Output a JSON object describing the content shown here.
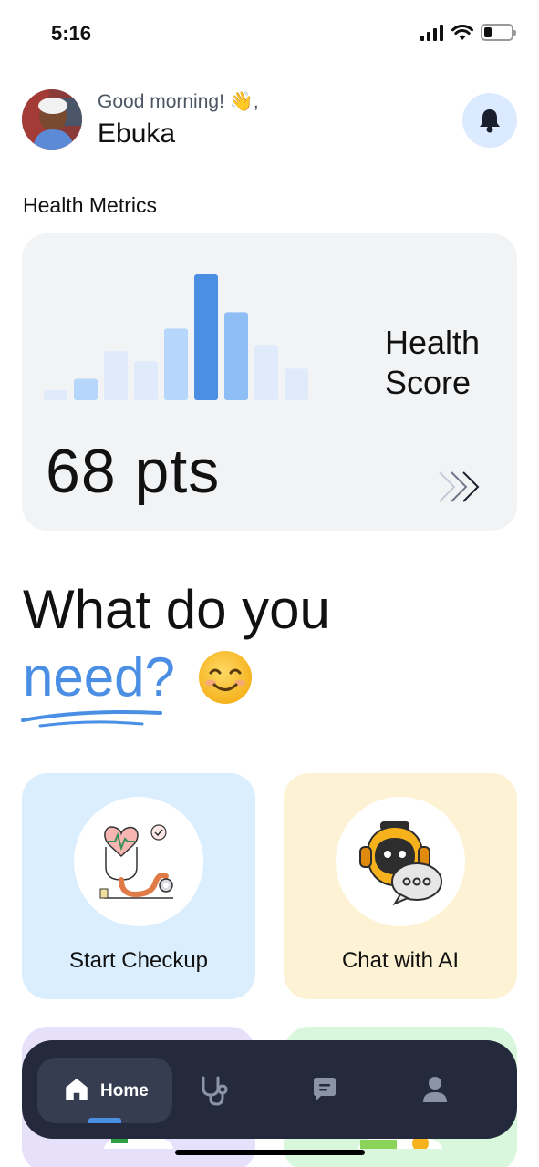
{
  "status_bar": {
    "time": "5:16"
  },
  "header": {
    "greeting": "Good morning! 👋,",
    "user_name": "Ebuka"
  },
  "metrics": {
    "section_title": "Health Metrics",
    "score_label_line1": "Health",
    "score_label_line2": "Score",
    "score_value": "68 pts",
    "bars": [
      {
        "level": 0.08,
        "tone": "faint"
      },
      {
        "level": 0.17,
        "tone": "light"
      },
      {
        "level": 0.39,
        "tone": "faint"
      },
      {
        "level": 0.31,
        "tone": "faint"
      },
      {
        "level": 0.57,
        "tone": "light"
      },
      {
        "level": 1.0,
        "tone": "strong"
      },
      {
        "level": 0.7,
        "tone": "medium"
      },
      {
        "level": 0.44,
        "tone": "faint"
      },
      {
        "level": 0.25,
        "tone": "faint"
      }
    ],
    "colors": {
      "strong": "#4a8fe4",
      "medium": "#8fbef5",
      "light": "#b7d6fb",
      "faint": "#dfeafb"
    }
  },
  "headline": {
    "line1": "What do you",
    "line2_accent": "need?",
    "accent_color": "#4a8fe4"
  },
  "tiles": [
    {
      "label": "Start Checkup",
      "icon": "stethoscope-heart-icon",
      "bg": "#dbeefe"
    },
    {
      "label": "Chat with AI",
      "icon": "ai-robot-chat-icon",
      "bg": "#fdf3d4"
    }
  ],
  "tabbar": {
    "home_label": "Home",
    "items": [
      "home-icon",
      "stethoscope-icon",
      "chat-icon",
      "profile-icon"
    ]
  }
}
